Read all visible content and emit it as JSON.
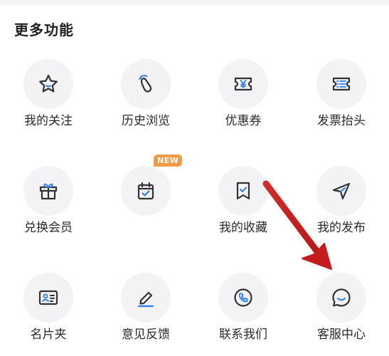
{
  "section": {
    "title": "更多功能"
  },
  "items": [
    {
      "label": "我的关注",
      "icon": "star-icon"
    },
    {
      "label": "历史浏览",
      "icon": "footprint-icon"
    },
    {
      "label": "优惠券",
      "icon": "coupon-icon"
    },
    {
      "label": "发票抬头",
      "icon": "invoice-icon"
    },
    {
      "label": "兑换会员",
      "icon": "gift-icon"
    },
    {
      "label": "",
      "icon": "calendar-check-icon",
      "badge": "NEW"
    },
    {
      "label": "我的收藏",
      "icon": "bookmark-check-icon"
    },
    {
      "label": "我的发布",
      "icon": "send-icon"
    },
    {
      "label": "名片夹",
      "icon": "id-card-icon"
    },
    {
      "label": "意见反馈",
      "icon": "pencil-icon"
    },
    {
      "label": "联系我们",
      "icon": "phone-icon"
    },
    {
      "label": "客服中心",
      "icon": "chat-bubble-icon"
    }
  ],
  "colors": {
    "icon_stroke": "#333333",
    "icon_accent": "#2b7bf0",
    "badge": "#f29a45",
    "arrow": "#c81e1e"
  }
}
